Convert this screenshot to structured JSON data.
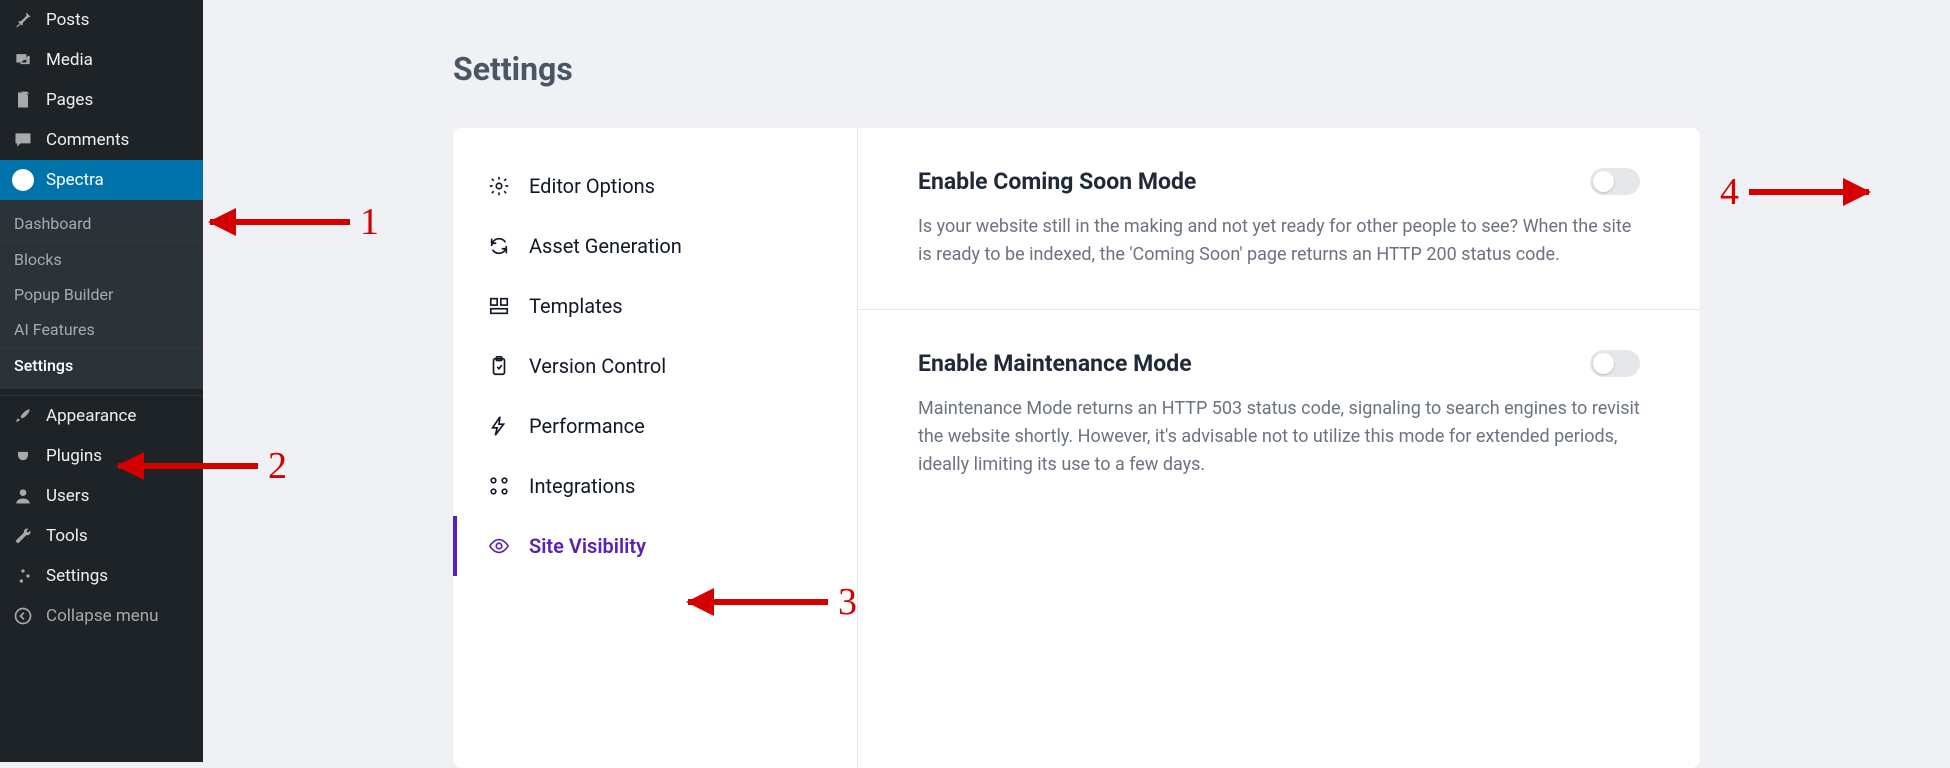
{
  "wp_sidebar": {
    "items": [
      {
        "label": "Posts"
      },
      {
        "label": "Media"
      },
      {
        "label": "Pages"
      },
      {
        "label": "Comments"
      },
      {
        "label": "Spectra"
      },
      {
        "label": "Appearance"
      },
      {
        "label": "Plugins"
      },
      {
        "label": "Users"
      },
      {
        "label": "Tools"
      },
      {
        "label": "Settings"
      },
      {
        "label": "Collapse menu"
      }
    ],
    "spectra_sub": [
      {
        "label": "Dashboard"
      },
      {
        "label": "Blocks"
      },
      {
        "label": "Popup Builder"
      },
      {
        "label": "AI Features"
      },
      {
        "label": "Settings"
      }
    ]
  },
  "page": {
    "title": "Settings"
  },
  "settings_nav": [
    {
      "label": "Editor Options"
    },
    {
      "label": "Asset Generation"
    },
    {
      "label": "Templates"
    },
    {
      "label": "Version Control"
    },
    {
      "label": "Performance"
    },
    {
      "label": "Integrations"
    },
    {
      "label": "Site Visibility"
    }
  ],
  "settings_body": {
    "coming_soon": {
      "title": "Enable Coming Soon Mode",
      "desc": "Is your website still in the making and not yet ready for other people to see? When the site is ready to be indexed, the 'Coming Soon' page returns an HTTP 200 status code."
    },
    "maintenance": {
      "title": "Enable Maintenance Mode",
      "desc": "Maintenance Mode returns an HTTP 503 status code, signaling to search engines to revisit the website shortly. However, it's advisable not to utilize this mode for extended periods, ideally limiting its use to a few days."
    }
  },
  "annotations": {
    "n1": "1",
    "n2": "2",
    "n3": "3",
    "n4": "4"
  }
}
